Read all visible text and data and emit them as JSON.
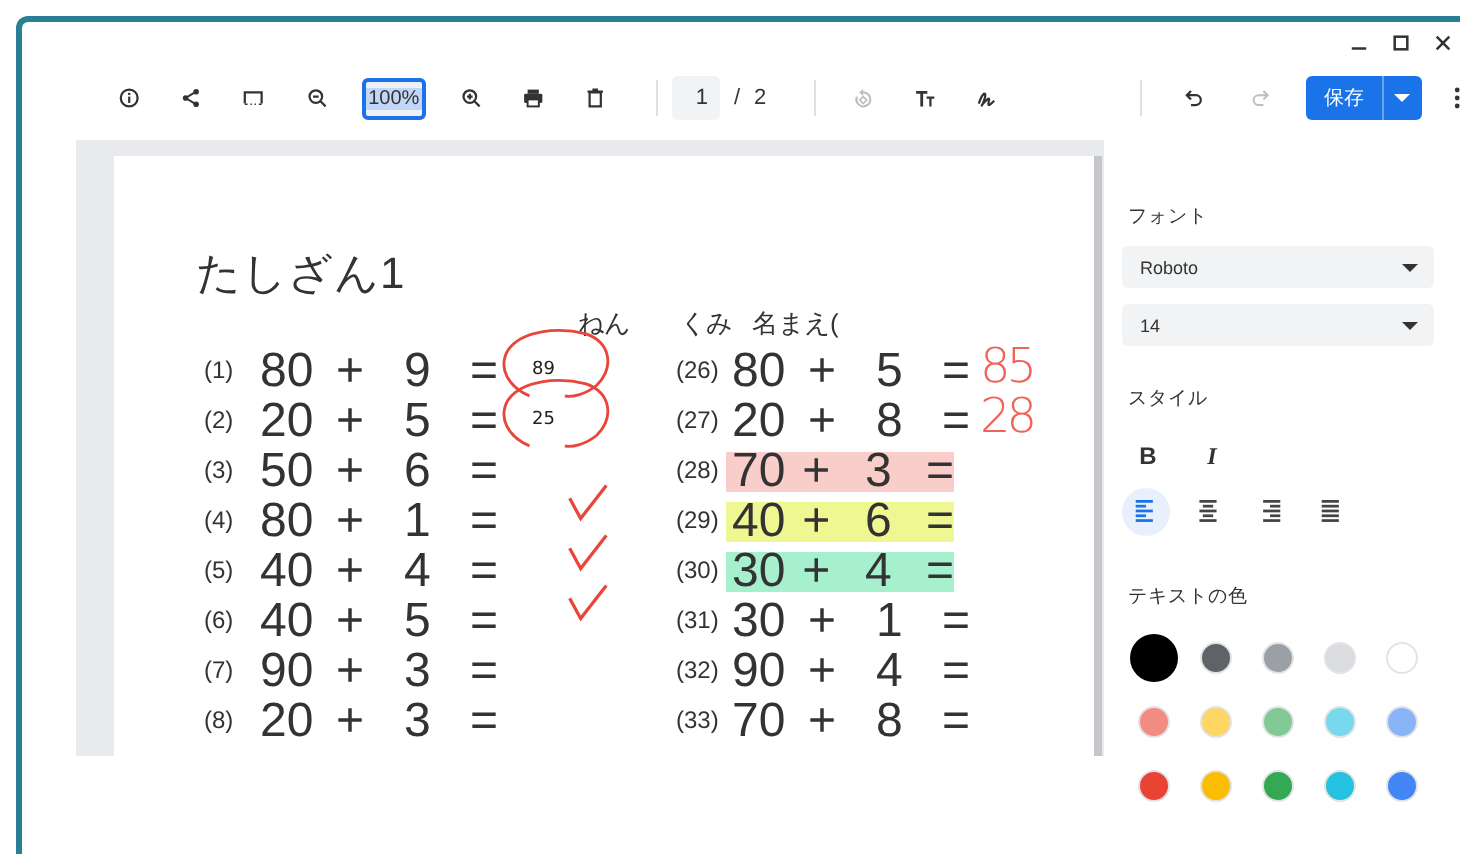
{
  "toolbar": {
    "zoom": "100%",
    "page_current": "1",
    "page_separator": "/",
    "page_total": "2",
    "tools": [
      {
        "kind": "info",
        "disabled": false
      },
      {
        "kind": "share",
        "disabled": false
      },
      {
        "kind": "fit",
        "disabled": false
      },
      {
        "kind": "zoom-out",
        "disabled": false
      },
      {
        "kind": "zoom-field"
      },
      {
        "kind": "zoom-in",
        "disabled": false
      },
      {
        "kind": "print",
        "disabled": false
      },
      {
        "kind": "delete",
        "disabled": false
      },
      {
        "kind": "page"
      },
      {
        "kind": "rotate",
        "disabled": true
      },
      {
        "kind": "text",
        "disabled": false
      },
      {
        "kind": "signature",
        "disabled": false
      },
      {
        "kind": "undo",
        "disabled": false
      },
      {
        "kind": "redo",
        "disabled": true
      }
    ],
    "save": "保存"
  },
  "document": {
    "title": "たしざん1",
    "header": [
      "ねん",
      "くみ",
      "名まえ("
    ],
    "left": [
      {
        "number": "(1)",
        "a": "80",
        "op": "+",
        "b": "9",
        "eq": "=",
        "answer": "89",
        "circled": true
      },
      {
        "number": "(2)",
        "a": "20",
        "op": "+",
        "b": "5",
        "eq": "=",
        "answer": "25",
        "circled": true
      },
      {
        "number": "(3)",
        "a": "50",
        "op": "+",
        "b": "6",
        "eq": "="
      },
      {
        "number": "(4)",
        "a": "80",
        "op": "+",
        "b": "1",
        "eq": "=",
        "checked": true
      },
      {
        "number": "(5)",
        "a": "40",
        "op": "+",
        "b": "4",
        "eq": "=",
        "checked": true
      },
      {
        "number": "(6)",
        "a": "40",
        "op": "+",
        "b": "5",
        "eq": "=",
        "checked": true
      },
      {
        "number": "(7)",
        "a": "90",
        "op": "+",
        "b": "3",
        "eq": "="
      },
      {
        "number": "(8)",
        "a": "20",
        "op": "+",
        "b": "3",
        "eq": "="
      }
    ],
    "right": [
      {
        "number": "(26)",
        "a": "80",
        "op": "+",
        "b": "5",
        "eq": "=",
        "handwritten": "85"
      },
      {
        "number": "(27)",
        "a": "20",
        "op": "+",
        "b": "8",
        "eq": "=",
        "handwritten": "28"
      },
      {
        "number": "(28)",
        "a": "70",
        "op": "+",
        "b": "3",
        "eq": "=",
        "color": "#f8cdca"
      },
      {
        "number": "(29)",
        "a": "40",
        "op": "+",
        "b": "6",
        "eq": "=",
        "color": "#eef792"
      },
      {
        "number": "(30)",
        "a": "30",
        "op": "+",
        "b": "4",
        "eq": "=",
        "color": "#a6f0cd"
      },
      {
        "number": "(31)",
        "a": "30",
        "op": "+",
        "b": "1",
        "eq": "="
      },
      {
        "number": "(32)",
        "a": "90",
        "op": "+",
        "b": "4",
        "eq": "="
      },
      {
        "number": "(33)",
        "a": "70",
        "op": "+",
        "b": "8",
        "eq": "="
      }
    ]
  },
  "sidebar": {
    "font_label": "フォント",
    "font": "Roboto",
    "size": "14",
    "style_label": "スタイル",
    "styles": [
      {
        "kind": "bold",
        "label": "B"
      },
      {
        "kind": "italic",
        "label": "I"
      }
    ],
    "alignments": [
      {
        "kind": "left",
        "selected": true
      },
      {
        "kind": "center",
        "selected": false
      },
      {
        "kind": "right",
        "selected": false
      },
      {
        "kind": "justify",
        "selected": false
      }
    ],
    "color_label": "テキストの色",
    "colors": [
      {
        "color": "#000000",
        "selected": true
      },
      {
        "color": "#5f6368",
        "selected": false
      },
      {
        "color": "#9aa0a6",
        "selected": false
      },
      {
        "color": "#dadce0",
        "selected": false
      },
      {
        "color": "#ffffff",
        "selected": false
      },
      {
        "color": "#f28b82",
        "selected": false
      },
      {
        "color": "#fdd663",
        "selected": false
      },
      {
        "color": "#81c995",
        "selected": false
      },
      {
        "color": "#78d9ec",
        "selected": false
      },
      {
        "color": "#8ab4f8",
        "selected": false
      },
      {
        "color": "#ea4335",
        "selected": false
      },
      {
        "color": "#fbbc04",
        "selected": false
      },
      {
        "color": "#34a853",
        "selected": false
      },
      {
        "color": "#24c1e0",
        "selected": false
      },
      {
        "color": "#4285f4",
        "selected": false
      }
    ]
  }
}
